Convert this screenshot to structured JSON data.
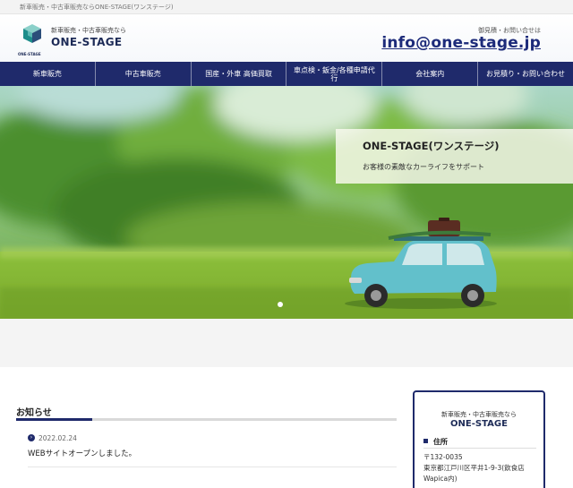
{
  "topbar": {
    "tagline": "新車販売・中古車販売ならONE-STAGE(ワンステージ)"
  },
  "header": {
    "brand_sub": "新車販売・中古車販売なら",
    "brand_main": "ONE-STAGE",
    "logo_text": "ONE-STAGE",
    "contact_label": "御見積・お問い合せは",
    "contact_email": "info@one-stage.jp"
  },
  "nav": {
    "items": [
      {
        "label": "新車販売"
      },
      {
        "label": "中古車販売"
      },
      {
        "label": "国産・外車 高価買取"
      },
      {
        "label": "車点検・鈑金/各種申請代行"
      },
      {
        "label": "会社案内"
      },
      {
        "label": "お見積り・お問い合わせ"
      }
    ]
  },
  "hero": {
    "title": "ONE-STAGE(ワンステージ)",
    "subtitle": "お客様の素敵なカーライフをサポート",
    "slide_count": 1,
    "active_slide": 1
  },
  "news": {
    "heading": "お知らせ",
    "items": [
      {
        "date": "2022.02.24",
        "title": "WEBサイトオープンしました。"
      }
    ]
  },
  "sidebar": {
    "sub": "新車販売・中古車販売なら",
    "main": "ONE-STAGE",
    "address_heading": "住所",
    "postal": "〒132-0035",
    "address": "東京都江戸川区平井1-9-3(飲食店Wapica内)"
  },
  "colors": {
    "primary_navy": "#1f2a6b",
    "brand_text": "#1d2b57",
    "email_blue": "#1d2b7a",
    "light_band": "#f4f4f4"
  },
  "icons": {
    "logo": "cube-logo-icon",
    "news_date": "chevron-right-circle-icon",
    "address_bullet": "square-bullet-icon"
  }
}
